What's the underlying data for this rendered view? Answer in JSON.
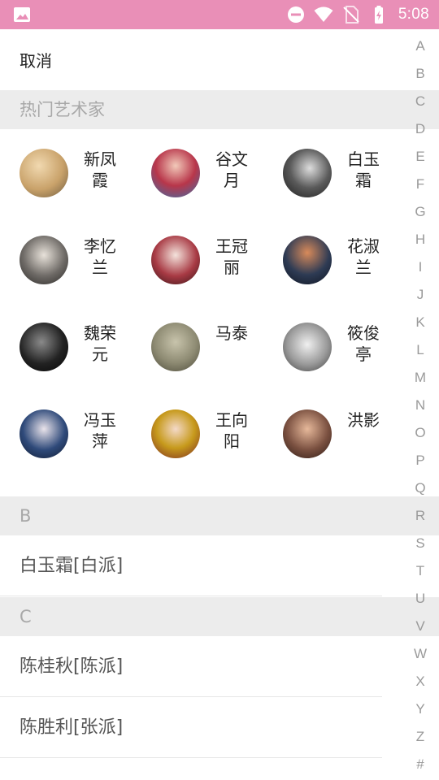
{
  "status_bar": {
    "time": "5:08",
    "icons": [
      "image-icon",
      "do-not-disturb-icon",
      "wifi-icon",
      "no-sim-icon",
      "battery-charging-icon"
    ],
    "background": "#e98fb7"
  },
  "header": {
    "cancel_label": "取消"
  },
  "hot_section": {
    "title": "热门艺术家"
  },
  "hot_artists": [
    {
      "name": "新凤霞",
      "avatar_color": "#c9a26a"
    },
    {
      "name": "谷文月",
      "avatar_color": "#b8364a"
    },
    {
      "name": "白玉霜",
      "avatar_color": "#5a5a5a"
    },
    {
      "name": "李忆兰",
      "avatar_color": "#6e6a66"
    },
    {
      "name": "王冠丽",
      "avatar_color": "#a83a44"
    },
    {
      "name": "花淑兰",
      "avatar_color": "#2e3b54"
    },
    {
      "name": "魏荣元",
      "avatar_color": "#222222"
    },
    {
      "name": "马泰",
      "avatar_color": "#8d8a72"
    },
    {
      "name": "筱俊亭",
      "avatar_color": "#9a9a9a"
    },
    {
      "name": "冯玉萍",
      "avatar_color": "#2f4a7a"
    },
    {
      "name": "王向阳",
      "avatar_color": "#c79a1c"
    },
    {
      "name": "洪影",
      "avatar_color": "#7a5040"
    }
  ],
  "sections": [
    {
      "letter": "B",
      "items": [
        "白玉霜[白派]"
      ]
    },
    {
      "letter": "C",
      "items": [
        "陈桂秋[陈派]",
        "陈胜利[张派]"
      ]
    }
  ],
  "index_bar": [
    "A",
    "B",
    "C",
    "D",
    "E",
    "F",
    "G",
    "H",
    "I",
    "J",
    "K",
    "L",
    "M",
    "N",
    "O",
    "P",
    "Q",
    "R",
    "S",
    "T",
    "U",
    "V",
    "W",
    "X",
    "Y",
    "Z",
    "#"
  ]
}
